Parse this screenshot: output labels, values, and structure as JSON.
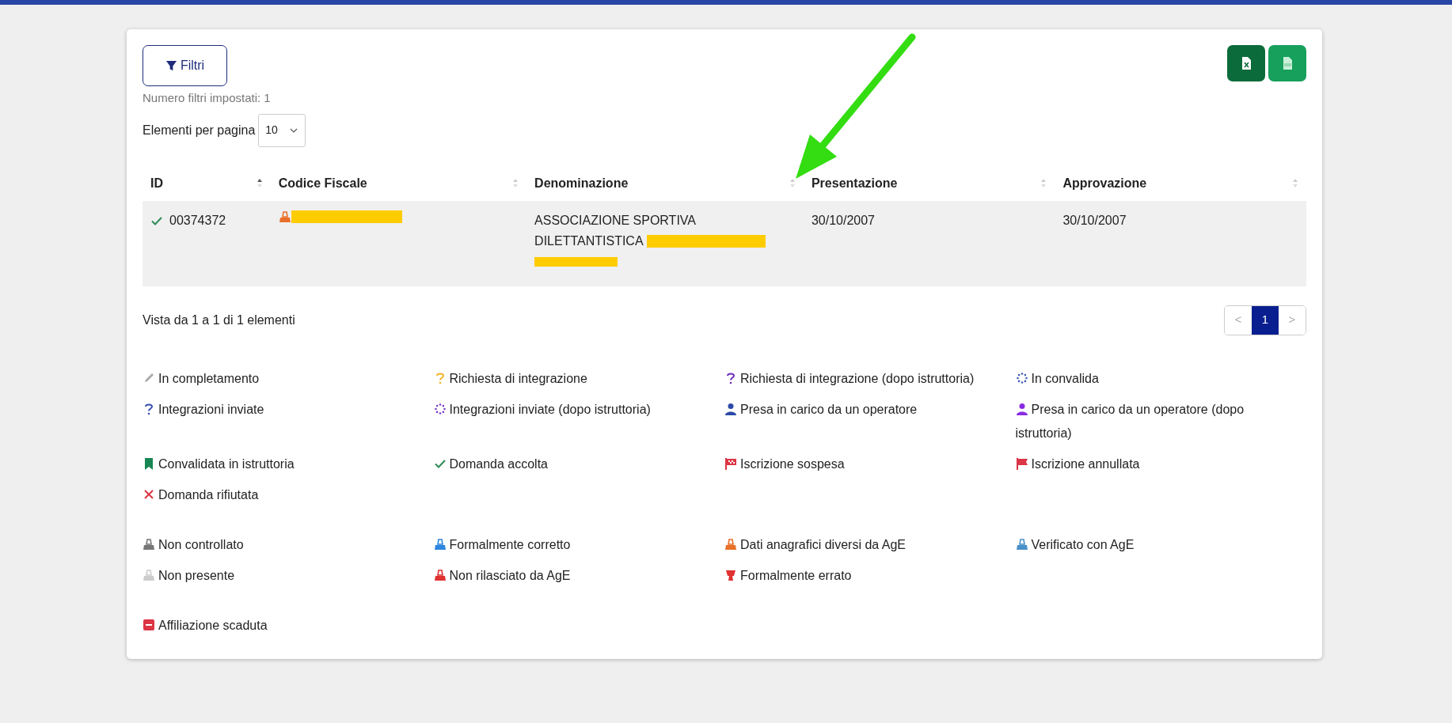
{
  "toolbar": {
    "filter_button": "Filtri",
    "filters_set": "Numero filtri impostati: 1",
    "page_size_label": "Elementi per pagina",
    "page_size": "10",
    "export_buttons": [
      {
        "kind": "excel"
      },
      {
        "kind": "csv"
      }
    ]
  },
  "table": {
    "columns": [
      {
        "label": "ID",
        "sorted": true
      },
      {
        "label": "Codice Fiscale",
        "sorted": false
      },
      {
        "label": "Denominazione",
        "sorted": false
      },
      {
        "label": "Presentazione",
        "sorted": false
      },
      {
        "label": "Approvazione",
        "sorted": false
      }
    ],
    "rows": [
      {
        "status_icon": {
          "kind": "check",
          "color": "#2e8b57"
        },
        "id": "00374372",
        "check_icon": {
          "kind": "stamp",
          "color": "#e8702a"
        },
        "denominazione": "ASSOCIAZIONE SPORTIVA DILETTANTISTICA",
        "presentazione": "30/10/2007",
        "approvazione": "30/10/2007"
      }
    ]
  },
  "summary": "Vista da 1 a 1 di 1 elementi",
  "pagination": {
    "prev": "<",
    "pages": [
      {
        "label": "1",
        "selected": true
      }
    ],
    "next": ">"
  },
  "legend_groups": [
    {
      "items": [
        {
          "kind": "pencil",
          "color": "#aaaaaa",
          "label": "In completamento"
        },
        {
          "kind": "question",
          "color": "#f0b429",
          "label": "Richiesta di integrazione"
        },
        {
          "kind": "question",
          "color": "#6f2dbd",
          "label": "Richiesta di integrazione (dopo istruttoria)"
        },
        {
          "kind": "spinner",
          "color": "#3b5bb5",
          "label": "In convalida"
        },
        {
          "kind": "question",
          "color": "#3b4fb0",
          "label": "Integrazioni inviate"
        },
        {
          "kind": "spinner",
          "color": "#7b3fc6",
          "label": "Integrazioni inviate (dopo istruttoria)"
        },
        {
          "kind": "person",
          "color": "#2c4aa8",
          "label": "Presa in carico da un operatore"
        },
        {
          "kind": "person",
          "color": "#8a2be2",
          "label": "Presa in carico da un operatore (dopo istruttoria)"
        },
        {
          "kind": "bookmark",
          "color": "#198754",
          "label": "Convalidata in istruttoria"
        },
        {
          "kind": "check",
          "color": "#2e8b57",
          "label": "Domanda accolta"
        },
        {
          "kind": "checkered-flag",
          "color": "#dc3545",
          "label": "Iscrizione sospesa"
        },
        {
          "kind": "flag",
          "color": "#dc3545",
          "label": "Iscrizione annullata"
        },
        {
          "kind": "cross",
          "color": "#dc3545",
          "label": "Domanda rifiutata"
        }
      ]
    },
    {
      "items": [
        {
          "kind": "stamp",
          "color": "#777777",
          "label": "Non controllato"
        },
        {
          "kind": "stamp",
          "color": "#2e86de",
          "label": "Formalmente corretto"
        },
        {
          "kind": "stamp",
          "color": "#e8702a",
          "label": "Dati anagrafici diversi da AgE"
        },
        {
          "kind": "stamp",
          "color": "#4a90c8",
          "label": "Verificato con AgE"
        },
        {
          "kind": "stamp",
          "color": "#cccccc",
          "label": "Non presente"
        },
        {
          "kind": "stamp",
          "color": "#e03131",
          "label": "Non rilasciato da AgE"
        },
        {
          "kind": "cup",
          "color": "#e03131",
          "label": "Formalmente errato"
        }
      ]
    },
    {
      "items": [
        {
          "kind": "minus-square",
          "color": "#dc3545",
          "label": "Affiliazione scaduta"
        }
      ]
    }
  ]
}
